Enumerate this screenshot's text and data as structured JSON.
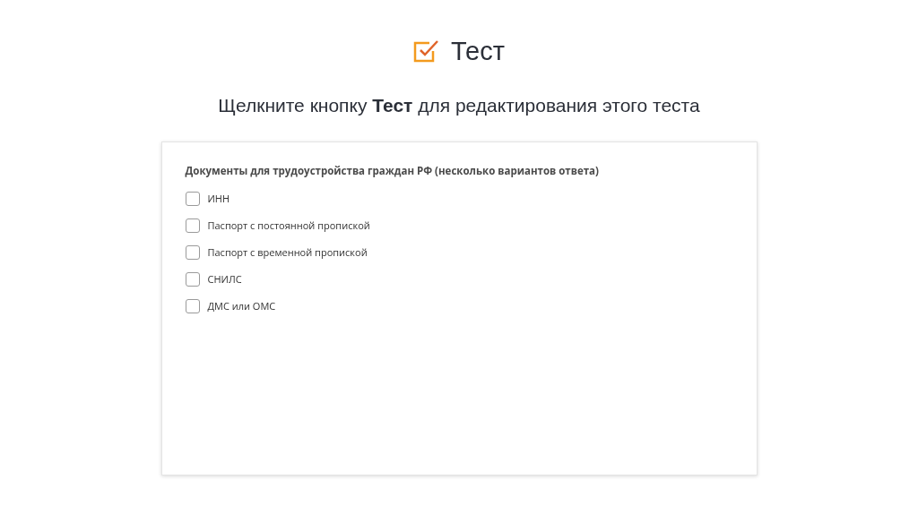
{
  "header": {
    "title": "Тест",
    "instruction": "Щелкните кнопку **Тест** для редактирования этого теста"
  },
  "question": {
    "text": "Документы для трудоустройства граждан РФ (несколько вариантов ответа)",
    "options": [
      {
        "label": "ИНН",
        "checked": false
      },
      {
        "label": "Паспорт с постоянной пропиской",
        "checked": false
      },
      {
        "label": "Паспорт с временной пропиской",
        "checked": false
      },
      {
        "label": "СНИЛС",
        "checked": false
      },
      {
        "label": "ДМС или ОМС",
        "checked": false
      }
    ]
  }
}
